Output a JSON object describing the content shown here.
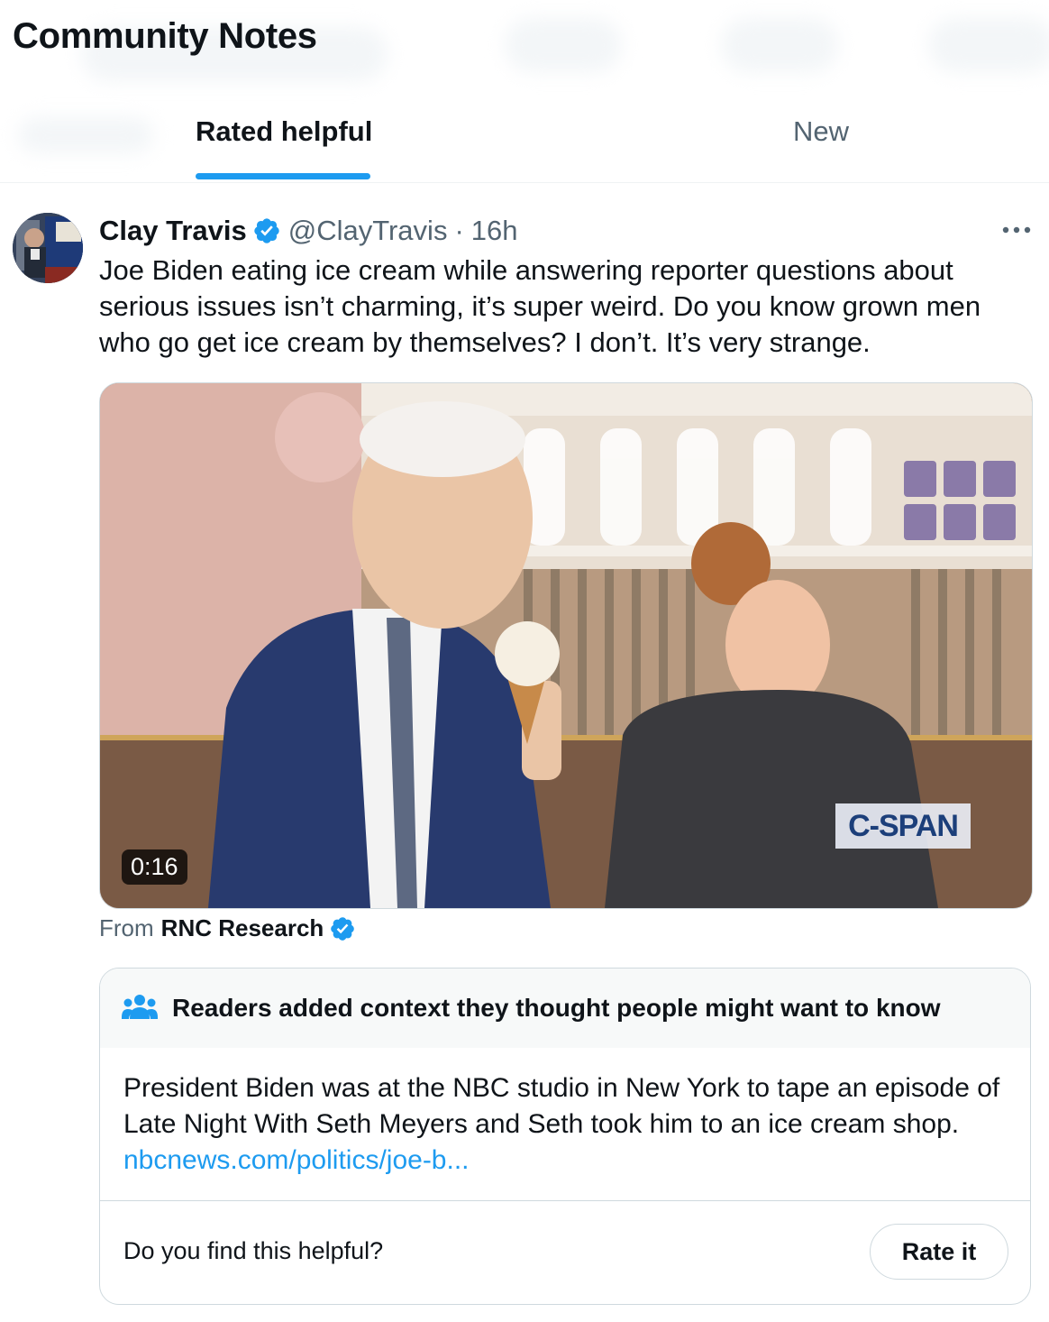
{
  "header": {
    "title": "Community Notes",
    "tabs": [
      {
        "label": "Rated helpful",
        "active": true
      },
      {
        "label": "New",
        "active": false
      }
    ]
  },
  "post": {
    "author_name": "Clay Travis",
    "handle": "@ClayTravis",
    "separator": "·",
    "time": "16h",
    "verified": true,
    "text": "Joe Biden eating ice cream while answering reporter questions about serious issues isn’t charming, it’s super weird. Do you know grown men who go get ice cream by themselves? I don’t. It’s very strange.",
    "media": {
      "duration": "0:16",
      "watermark": "C-SPAN"
    },
    "from_prefix": "From",
    "from_source": "RNC Research"
  },
  "note": {
    "heading": "Readers added context they thought people might want to know",
    "body": "President Biden was at the NBC studio in New York to tape an episode of Late Night With Seth Meyers and Seth took him to an ice cream shop.",
    "link": "nbcnews.com/politics/joe-b...",
    "question": "Do you find this helpful?",
    "rate_label": "Rate it"
  },
  "colors": {
    "accent": "#1d9bf0",
    "text_primary": "#0f1419",
    "text_secondary": "#536471",
    "border": "#cfd9de"
  },
  "icons": [
    "verified-badge-icon",
    "more-options-icon",
    "people-icon"
  ]
}
